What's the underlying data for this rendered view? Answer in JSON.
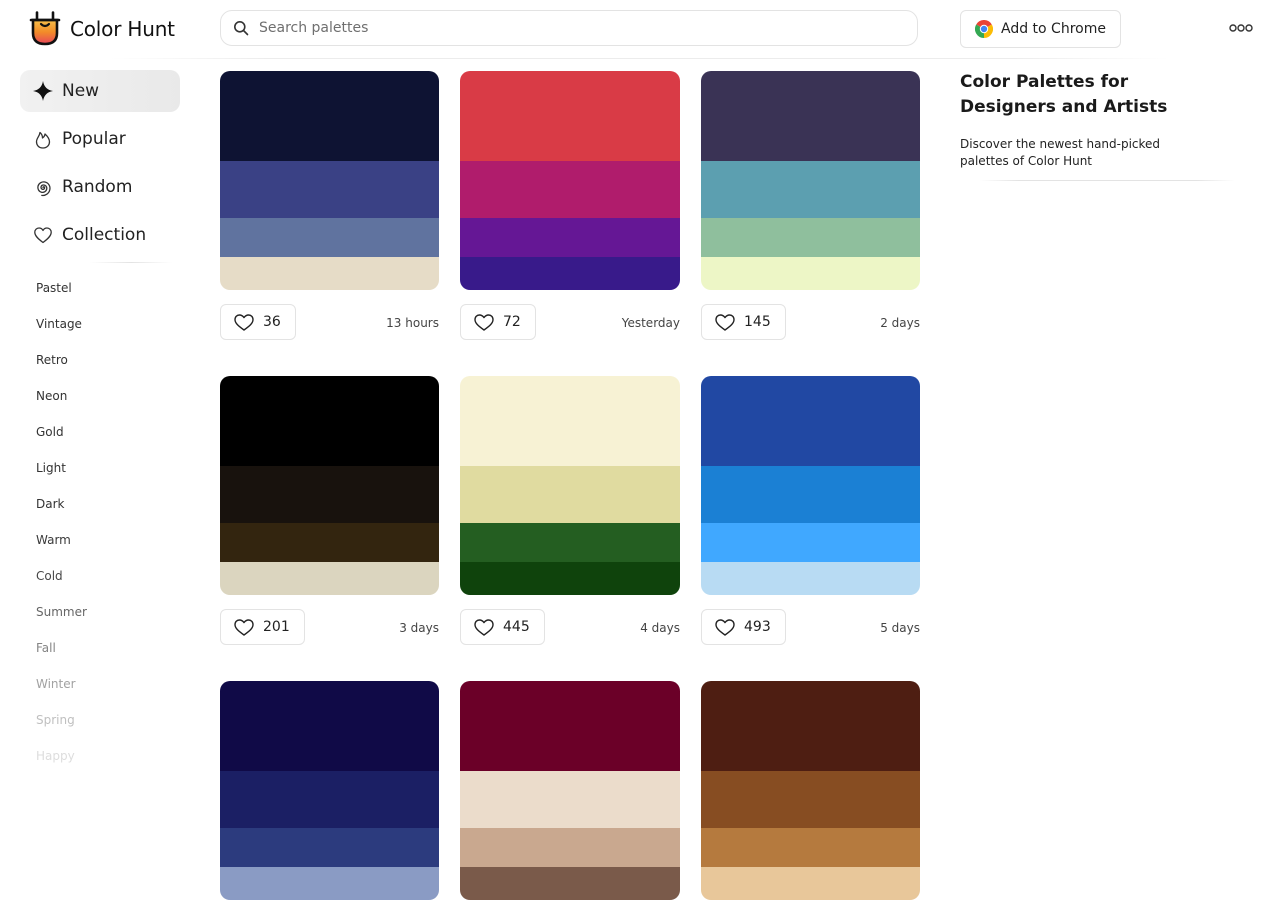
{
  "header": {
    "app_name": "Color Hunt",
    "search_placeholder": "Search palettes",
    "add_chrome_label": "Add to Chrome"
  },
  "icons": {
    "logo": "color-hunt-logo-icon",
    "search": "search-icon",
    "chrome": "chrome-icon",
    "more": "more-icon",
    "new": "sparkle-icon",
    "popular": "flame-icon",
    "random": "spiral-icon",
    "collection": "heart-icon",
    "like": "heart-icon"
  },
  "sidebar": {
    "nav": [
      {
        "id": "new",
        "label": "New",
        "active": true
      },
      {
        "id": "popular",
        "label": "Popular",
        "active": false
      },
      {
        "id": "random",
        "label": "Random",
        "active": false
      },
      {
        "id": "collection",
        "label": "Collection",
        "active": false
      }
    ],
    "tags": [
      "Pastel",
      "Vintage",
      "Retro",
      "Neon",
      "Gold",
      "Light",
      "Dark",
      "Warm",
      "Cold",
      "Summer",
      "Fall",
      "Winter",
      "Spring",
      "Happy"
    ]
  },
  "palettes": [
    {
      "colors": [
        "#0E1333",
        "#3A4185",
        "#60739F",
        "#E6DCC7"
      ],
      "likes": "36",
      "time": "13 hours"
    },
    {
      "colors": [
        "#D93B46",
        "#B01C6C",
        "#651795",
        "#381A8A"
      ],
      "likes": "72",
      "time": "Yesterday"
    },
    {
      "colors": [
        "#3A3355",
        "#5C9FB0",
        "#8FBF9D",
        "#EDF6C6"
      ],
      "likes": "145",
      "time": "2 days"
    },
    {
      "colors": [
        "#000000",
        "#18120D",
        "#33250F",
        "#DBD5BF"
      ],
      "likes": "201",
      "time": "3 days"
    },
    {
      "colors": [
        "#F7F2D4",
        "#E0DBA0",
        "#245E21",
        "#0F430C"
      ],
      "likes": "445",
      "time": "4 days"
    },
    {
      "colors": [
        "#2148A3",
        "#1B80D4",
        "#40A8FF",
        "#B8DBF3"
      ],
      "likes": "493",
      "time": "5 days"
    },
    {
      "colors": [
        "#100A47",
        "#1B1F64",
        "#2C3B7E",
        "#8A9BC4"
      ],
      "likes": "",
      "time": ""
    },
    {
      "colors": [
        "#6B0028",
        "#EBDCCB",
        "#C9A88F",
        "#7A5A4A"
      ],
      "likes": "",
      "time": ""
    },
    {
      "colors": [
        "#4E1E12",
        "#874D22",
        "#B57A3E",
        "#E8C79A"
      ],
      "likes": "",
      "time": ""
    }
  ],
  "info": {
    "title": "Color Palettes for Designers and Artists",
    "description": "Discover the newest hand-picked palettes of Color Hunt"
  }
}
